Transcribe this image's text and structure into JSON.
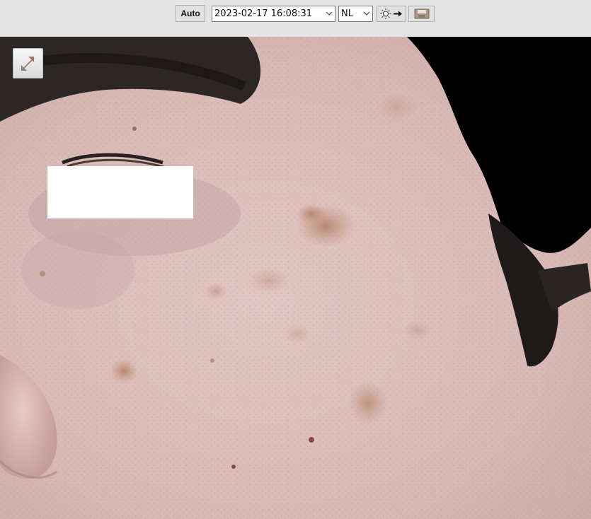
{
  "toolbar": {
    "auto_label": "Auto",
    "date_selected": "2023-02-17 16:08:31",
    "mode_selected": "NL",
    "brightness_icon": "sun-arrow-icon",
    "save_icon": "save-icon"
  },
  "viewer": {
    "expand_icon": "expand-diagonal-icon",
    "redaction_color": "#ffffff",
    "skin_color": "#d9bcb9",
    "background_color": "#000000"
  }
}
